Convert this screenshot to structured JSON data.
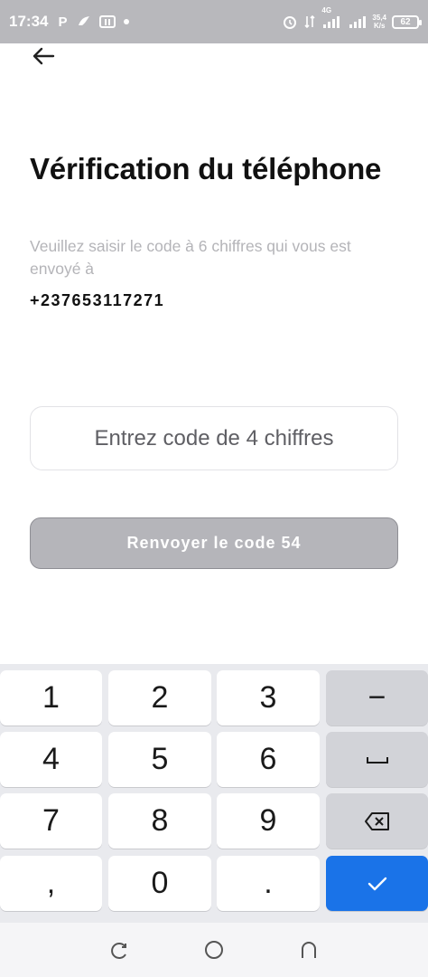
{
  "status_bar": {
    "time": "17:34",
    "network": "4G",
    "speed_value": "35,4",
    "speed_unit": "K/s",
    "battery": "62"
  },
  "header": {
    "back_icon": "arrow-left-icon"
  },
  "main": {
    "title": "Vérification du téléphone",
    "subtitle": "Veuillez saisir le code à 6 chiffres qui vous est envoyé à",
    "phone_number": "+237653117271",
    "code_input": {
      "placeholder": "Entrez code de 4 chiffres",
      "value": ""
    },
    "resend_button": "Renvoyer le code 54"
  },
  "keyboard": {
    "keys": [
      "1",
      "2",
      "3",
      "−",
      "4",
      "5",
      "6",
      "␣",
      "7",
      "8",
      "9",
      "⌫",
      ",",
      "0",
      ".",
      "✓"
    ]
  },
  "colors": {
    "accent": "#1a73e8",
    "status_bar": "#b8b8bc",
    "disabled_button": "#b5b5ba"
  }
}
